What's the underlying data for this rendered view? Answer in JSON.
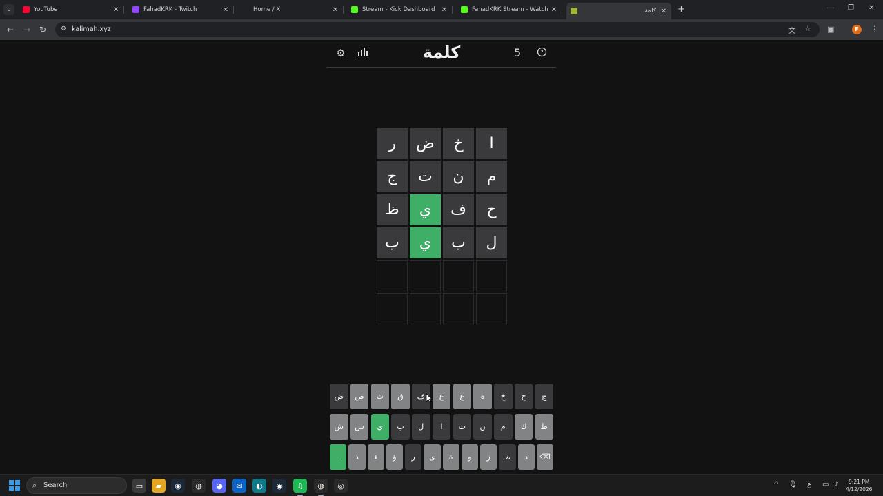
{
  "browser": {
    "tabs": [
      {
        "title": "YouTube",
        "favicon": "youtube-icon",
        "color": "#ff0033"
      },
      {
        "title": "FahadKRK - Twitch",
        "favicon": "twitch-icon",
        "color": "#9146ff"
      },
      {
        "title": "Home / X",
        "favicon": "x-icon",
        "color": "#202124"
      },
      {
        "title": "Stream - Kick Dashboard",
        "favicon": "kick-icon",
        "color": "#53fc18"
      },
      {
        "title": "FahadKRK Stream - Watch Live",
        "favicon": "kick-icon",
        "color": "#53fc18"
      },
      {
        "title": "كلمة",
        "favicon": "kalimah-icon",
        "color": "#9ab83a",
        "active": true
      }
    ],
    "url": "kalimah.xyz",
    "profile_initial": "F"
  },
  "game": {
    "title": "كلمة",
    "streak": "5",
    "board": [
      [
        {
          "l": "ا",
          "s": "absent"
        },
        {
          "l": "خ",
          "s": "absent"
        },
        {
          "l": "ض",
          "s": "absent"
        },
        {
          "l": "ر",
          "s": "absent"
        }
      ],
      [
        {
          "l": "م",
          "s": "absent"
        },
        {
          "l": "ن",
          "s": "absent"
        },
        {
          "l": "ت",
          "s": "absent"
        },
        {
          "l": "ج",
          "s": "absent"
        }
      ],
      [
        {
          "l": "ح",
          "s": "absent"
        },
        {
          "l": "ف",
          "s": "absent"
        },
        {
          "l": "ي",
          "s": "correct"
        },
        {
          "l": "ظ",
          "s": "absent"
        }
      ],
      [
        {
          "l": "ل",
          "s": "absent"
        },
        {
          "l": "ب",
          "s": "absent"
        },
        {
          "l": "ي",
          "s": "correct"
        },
        {
          "l": "ب",
          "s": "absent"
        }
      ],
      [
        {
          "l": "",
          "s": "empty"
        },
        {
          "l": "",
          "s": "empty"
        },
        {
          "l": "",
          "s": "empty"
        },
        {
          "l": "",
          "s": "empty"
        }
      ],
      [
        {
          "l": "",
          "s": "empty"
        },
        {
          "l": "",
          "s": "empty"
        },
        {
          "l": "",
          "s": "empty"
        },
        {
          "l": "",
          "s": "empty"
        }
      ]
    ],
    "keyboard": [
      [
        {
          "k": "ج",
          "s": "absent"
        },
        {
          "k": "ح",
          "s": "absent"
        },
        {
          "k": "خ",
          "s": "absent"
        },
        {
          "k": "ه",
          "s": "unused"
        },
        {
          "k": "ع",
          "s": "unused"
        },
        {
          "k": "غ",
          "s": "unused"
        },
        {
          "k": "ف",
          "s": "absent"
        },
        {
          "k": "ق",
          "s": "unused"
        },
        {
          "k": "ث",
          "s": "unused"
        },
        {
          "k": "ص",
          "s": "unused"
        },
        {
          "k": "ض",
          "s": "absent"
        }
      ],
      [
        {
          "k": "ط",
          "s": "unused"
        },
        {
          "k": "ك",
          "s": "unused"
        },
        {
          "k": "م",
          "s": "absent"
        },
        {
          "k": "ن",
          "s": "absent"
        },
        {
          "k": "ت",
          "s": "absent"
        },
        {
          "k": "ا",
          "s": "absent"
        },
        {
          "k": "ل",
          "s": "absent"
        },
        {
          "k": "ب",
          "s": "absent"
        },
        {
          "k": "ي",
          "s": "correct"
        },
        {
          "k": "س",
          "s": "unused"
        },
        {
          "k": "ش",
          "s": "unused"
        }
      ],
      [
        {
          "k": "⌫",
          "s": "unused"
        },
        {
          "k": "د",
          "s": "unused"
        },
        {
          "k": "ظ",
          "s": "absent"
        },
        {
          "k": "ز",
          "s": "unused"
        },
        {
          "k": "و",
          "s": "unused"
        },
        {
          "k": "ة",
          "s": "unused"
        },
        {
          "k": "ى",
          "s": "unused"
        },
        {
          "k": "ر",
          "s": "absent"
        },
        {
          "k": "ؤ",
          "s": "unused"
        },
        {
          "k": "ء",
          "s": "unused"
        },
        {
          "k": "ذ",
          "s": "unused"
        },
        {
          "k": "ـ",
          "s": "correct"
        }
      ]
    ]
  },
  "taskbar": {
    "search_label": "Search",
    "time": "9:21 PM",
    "date": "4/12/2026",
    "lang": "ع"
  }
}
